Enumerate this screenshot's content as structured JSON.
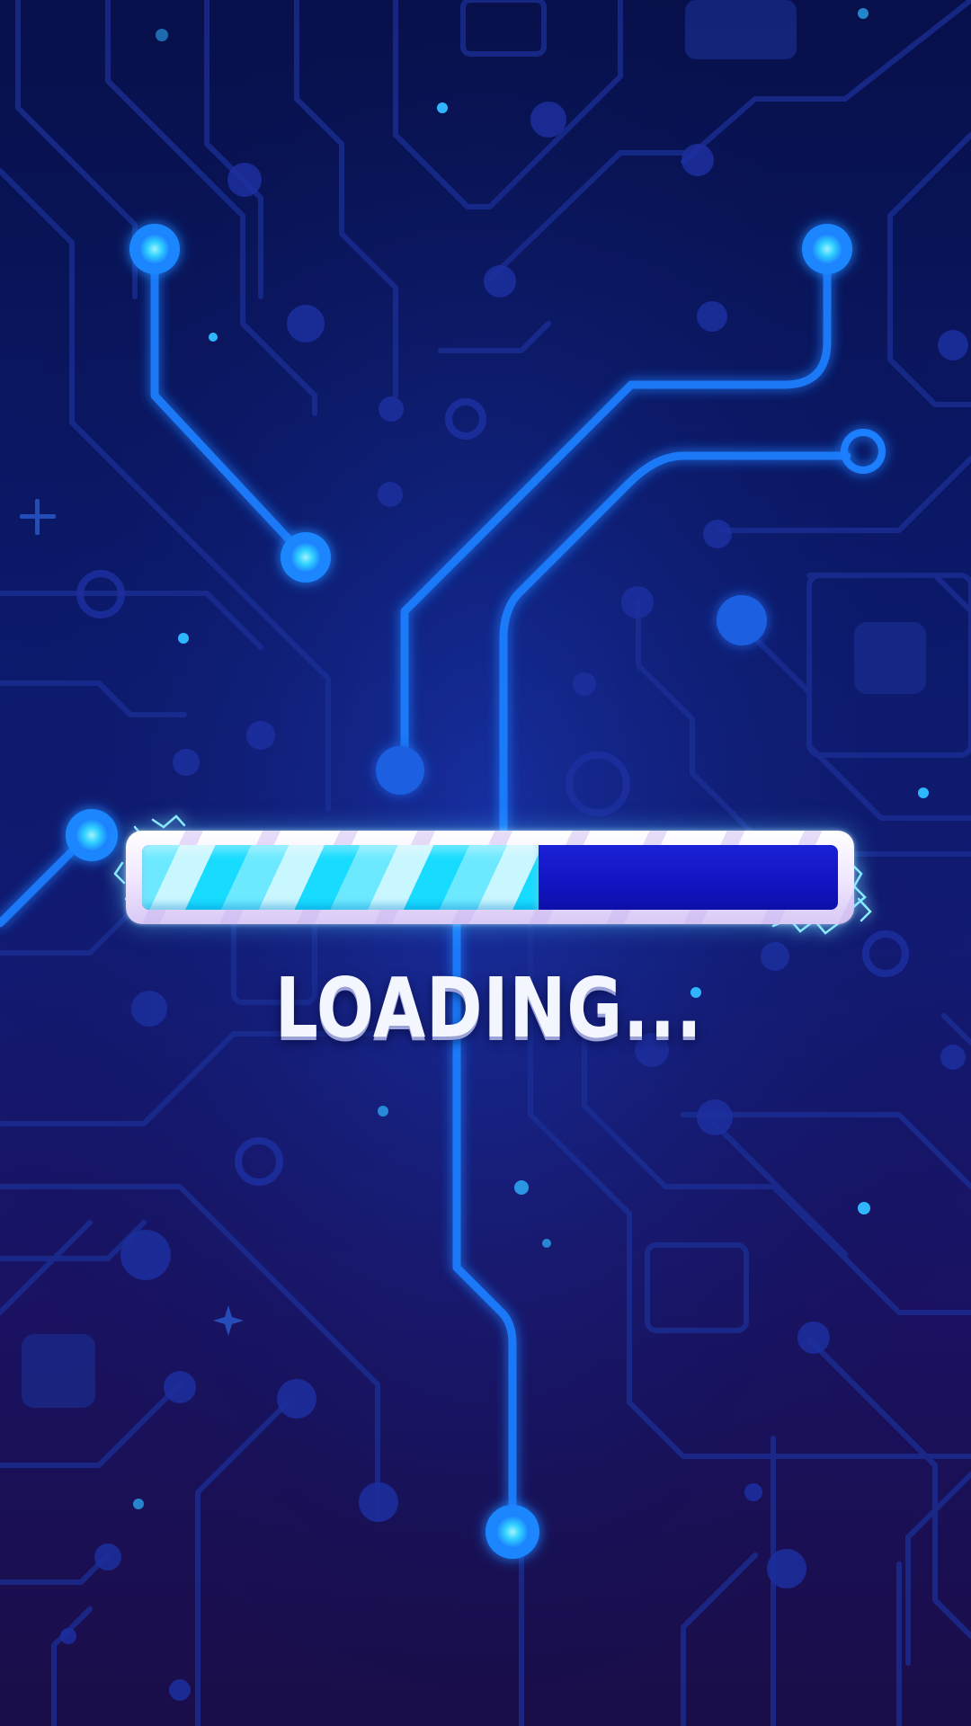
{
  "loading": {
    "label": "LOADING...",
    "progress_fraction": 0.57
  },
  "colors": {
    "background_top": "#07104a",
    "background_bottom": "#1a0d48",
    "circuit_line": "#1d3aa8",
    "circuit_glow": "#1fa2ff",
    "node_core": "#5fe1ff",
    "bar_fill": "#17dcff",
    "bar_track": "#1315c4",
    "bar_frame": "#efe6ff",
    "text": "#f4f6ff"
  },
  "icons": {
    "spark_left": "electric-spark-icon",
    "spark_right": "electric-spark-icon",
    "plus_marks": "plus-sparkle-icon"
  }
}
